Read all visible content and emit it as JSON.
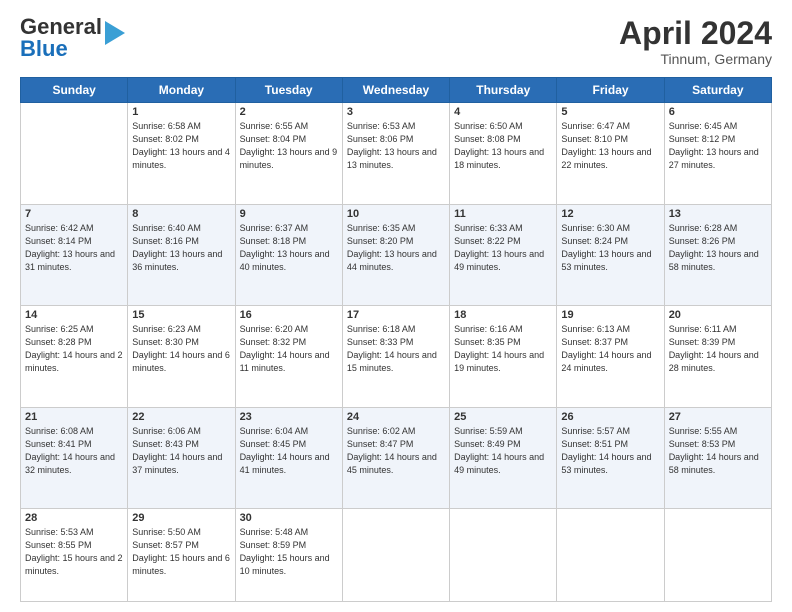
{
  "header": {
    "logo_general": "General",
    "logo_blue": "Blue",
    "month": "April 2024",
    "location": "Tinnum, Germany"
  },
  "days_of_week": [
    "Sunday",
    "Monday",
    "Tuesday",
    "Wednesday",
    "Thursday",
    "Friday",
    "Saturday"
  ],
  "weeks": [
    [
      {
        "num": "",
        "sunrise": "",
        "sunset": "",
        "daylight": ""
      },
      {
        "num": "1",
        "sunrise": "Sunrise: 6:58 AM",
        "sunset": "Sunset: 8:02 PM",
        "daylight": "Daylight: 13 hours and 4 minutes."
      },
      {
        "num": "2",
        "sunrise": "Sunrise: 6:55 AM",
        "sunset": "Sunset: 8:04 PM",
        "daylight": "Daylight: 13 hours and 9 minutes."
      },
      {
        "num": "3",
        "sunrise": "Sunrise: 6:53 AM",
        "sunset": "Sunset: 8:06 PM",
        "daylight": "Daylight: 13 hours and 13 minutes."
      },
      {
        "num": "4",
        "sunrise": "Sunrise: 6:50 AM",
        "sunset": "Sunset: 8:08 PM",
        "daylight": "Daylight: 13 hours and 18 minutes."
      },
      {
        "num": "5",
        "sunrise": "Sunrise: 6:47 AM",
        "sunset": "Sunset: 8:10 PM",
        "daylight": "Daylight: 13 hours and 22 minutes."
      },
      {
        "num": "6",
        "sunrise": "Sunrise: 6:45 AM",
        "sunset": "Sunset: 8:12 PM",
        "daylight": "Daylight: 13 hours and 27 minutes."
      }
    ],
    [
      {
        "num": "7",
        "sunrise": "Sunrise: 6:42 AM",
        "sunset": "Sunset: 8:14 PM",
        "daylight": "Daylight: 13 hours and 31 minutes."
      },
      {
        "num": "8",
        "sunrise": "Sunrise: 6:40 AM",
        "sunset": "Sunset: 8:16 PM",
        "daylight": "Daylight: 13 hours and 36 minutes."
      },
      {
        "num": "9",
        "sunrise": "Sunrise: 6:37 AM",
        "sunset": "Sunset: 8:18 PM",
        "daylight": "Daylight: 13 hours and 40 minutes."
      },
      {
        "num": "10",
        "sunrise": "Sunrise: 6:35 AM",
        "sunset": "Sunset: 8:20 PM",
        "daylight": "Daylight: 13 hours and 44 minutes."
      },
      {
        "num": "11",
        "sunrise": "Sunrise: 6:33 AM",
        "sunset": "Sunset: 8:22 PM",
        "daylight": "Daylight: 13 hours and 49 minutes."
      },
      {
        "num": "12",
        "sunrise": "Sunrise: 6:30 AM",
        "sunset": "Sunset: 8:24 PM",
        "daylight": "Daylight: 13 hours and 53 minutes."
      },
      {
        "num": "13",
        "sunrise": "Sunrise: 6:28 AM",
        "sunset": "Sunset: 8:26 PM",
        "daylight": "Daylight: 13 hours and 58 minutes."
      }
    ],
    [
      {
        "num": "14",
        "sunrise": "Sunrise: 6:25 AM",
        "sunset": "Sunset: 8:28 PM",
        "daylight": "Daylight: 14 hours and 2 minutes."
      },
      {
        "num": "15",
        "sunrise": "Sunrise: 6:23 AM",
        "sunset": "Sunset: 8:30 PM",
        "daylight": "Daylight: 14 hours and 6 minutes."
      },
      {
        "num": "16",
        "sunrise": "Sunrise: 6:20 AM",
        "sunset": "Sunset: 8:32 PM",
        "daylight": "Daylight: 14 hours and 11 minutes."
      },
      {
        "num": "17",
        "sunrise": "Sunrise: 6:18 AM",
        "sunset": "Sunset: 8:33 PM",
        "daylight": "Daylight: 14 hours and 15 minutes."
      },
      {
        "num": "18",
        "sunrise": "Sunrise: 6:16 AM",
        "sunset": "Sunset: 8:35 PM",
        "daylight": "Daylight: 14 hours and 19 minutes."
      },
      {
        "num": "19",
        "sunrise": "Sunrise: 6:13 AM",
        "sunset": "Sunset: 8:37 PM",
        "daylight": "Daylight: 14 hours and 24 minutes."
      },
      {
        "num": "20",
        "sunrise": "Sunrise: 6:11 AM",
        "sunset": "Sunset: 8:39 PM",
        "daylight": "Daylight: 14 hours and 28 minutes."
      }
    ],
    [
      {
        "num": "21",
        "sunrise": "Sunrise: 6:08 AM",
        "sunset": "Sunset: 8:41 PM",
        "daylight": "Daylight: 14 hours and 32 minutes."
      },
      {
        "num": "22",
        "sunrise": "Sunrise: 6:06 AM",
        "sunset": "Sunset: 8:43 PM",
        "daylight": "Daylight: 14 hours and 37 minutes."
      },
      {
        "num": "23",
        "sunrise": "Sunrise: 6:04 AM",
        "sunset": "Sunset: 8:45 PM",
        "daylight": "Daylight: 14 hours and 41 minutes."
      },
      {
        "num": "24",
        "sunrise": "Sunrise: 6:02 AM",
        "sunset": "Sunset: 8:47 PM",
        "daylight": "Daylight: 14 hours and 45 minutes."
      },
      {
        "num": "25",
        "sunrise": "Sunrise: 5:59 AM",
        "sunset": "Sunset: 8:49 PM",
        "daylight": "Daylight: 14 hours and 49 minutes."
      },
      {
        "num": "26",
        "sunrise": "Sunrise: 5:57 AM",
        "sunset": "Sunset: 8:51 PM",
        "daylight": "Daylight: 14 hours and 53 minutes."
      },
      {
        "num": "27",
        "sunrise": "Sunrise: 5:55 AM",
        "sunset": "Sunset: 8:53 PM",
        "daylight": "Daylight: 14 hours and 58 minutes."
      }
    ],
    [
      {
        "num": "28",
        "sunrise": "Sunrise: 5:53 AM",
        "sunset": "Sunset: 8:55 PM",
        "daylight": "Daylight: 15 hours and 2 minutes."
      },
      {
        "num": "29",
        "sunrise": "Sunrise: 5:50 AM",
        "sunset": "Sunset: 8:57 PM",
        "daylight": "Daylight: 15 hours and 6 minutes."
      },
      {
        "num": "30",
        "sunrise": "Sunrise: 5:48 AM",
        "sunset": "Sunset: 8:59 PM",
        "daylight": "Daylight: 15 hours and 10 minutes."
      },
      {
        "num": "",
        "sunrise": "",
        "sunset": "",
        "daylight": ""
      },
      {
        "num": "",
        "sunrise": "",
        "sunset": "",
        "daylight": ""
      },
      {
        "num": "",
        "sunrise": "",
        "sunset": "",
        "daylight": ""
      },
      {
        "num": "",
        "sunrise": "",
        "sunset": "",
        "daylight": ""
      }
    ]
  ]
}
